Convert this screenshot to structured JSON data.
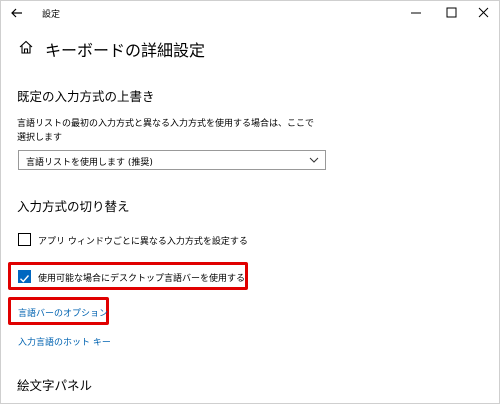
{
  "window": {
    "title": "設定",
    "back_icon": "arrow-left-icon",
    "minimize_icon": "minimize-icon",
    "maximize_icon": "maximize-icon",
    "close_icon": "close-icon"
  },
  "page": {
    "icon": "home-icon",
    "title": "キーボードの詳細設定"
  },
  "override": {
    "heading": "既定の入力方式の上書き",
    "description_line1": "言語リストの最初の入力方式と異なる入力方式を使用する場合は、ここで",
    "description_line2": "選択します",
    "select_value": "言語リストを使用します (推奨)"
  },
  "switching": {
    "heading": "入力方式の切り替え",
    "per_app_label": "アプリ ウィンドウごとに異なる入力方式を設定する",
    "per_app_checked": false,
    "desktop_bar_label": "使用可能な場合にデスクトップ言語バーを使用する",
    "desktop_bar_checked": true,
    "options_link": "言語バーのオプション",
    "hotkeys_link": "入力言語のホット キー"
  },
  "emoji": {
    "heading": "絵文字パネル"
  },
  "colors": {
    "accent": "#0067c0",
    "link": "#0063b1",
    "highlight": "#e00000"
  }
}
